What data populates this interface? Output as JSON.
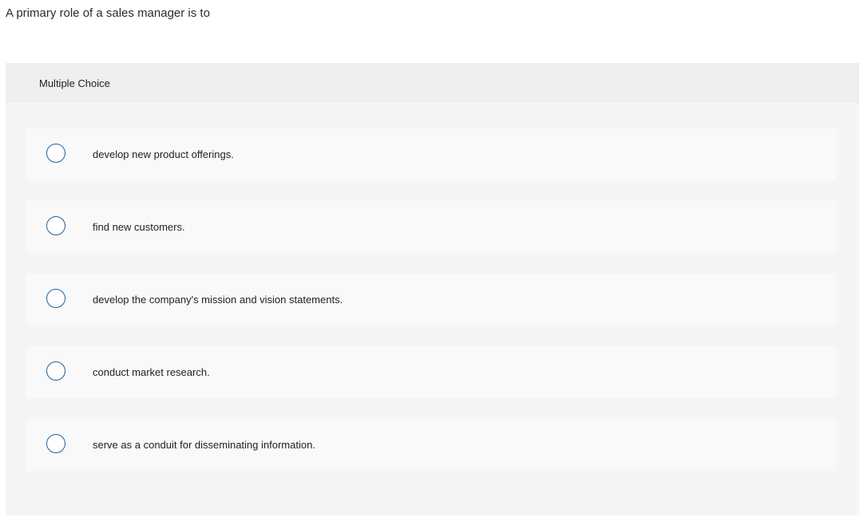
{
  "question": {
    "text": "A primary role of a sales manager is to"
  },
  "panel": {
    "type_label": "Multiple Choice"
  },
  "options": [
    {
      "label": "develop new product offerings."
    },
    {
      "label": "find new customers."
    },
    {
      "label": "develop the company's mission and vision statements."
    },
    {
      "label": "conduct market research."
    },
    {
      "label": "serve as a conduit for disseminating information."
    }
  ],
  "colors": {
    "radio_border": "#1f5f99",
    "panel_bg": "#f5f5f5",
    "header_bg": "#efefef",
    "option_bg": "#f9f9f9"
  }
}
